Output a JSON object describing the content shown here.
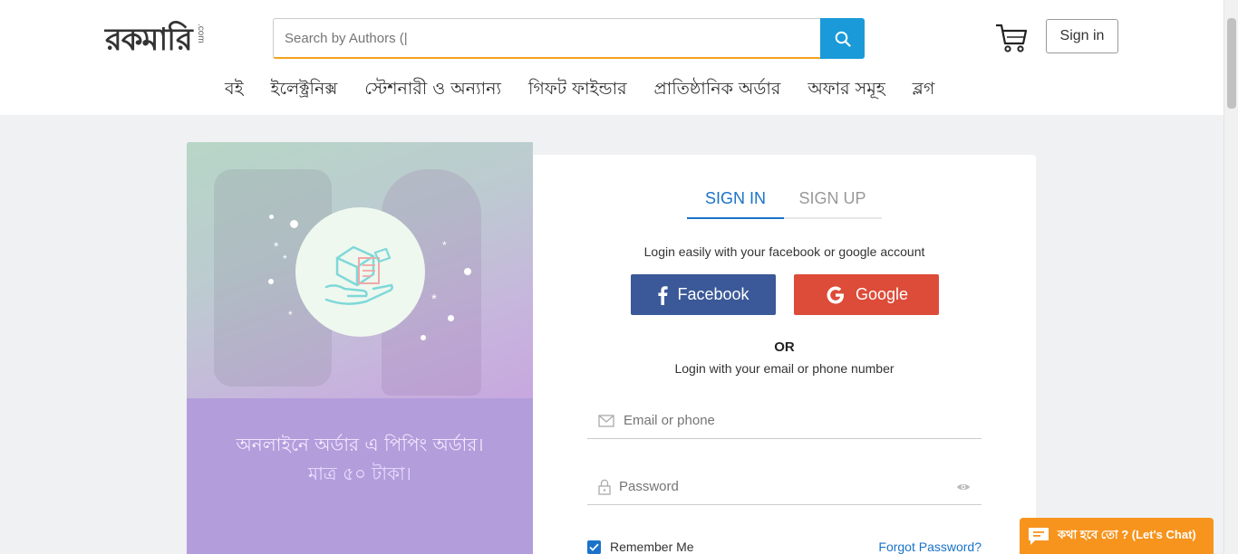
{
  "header": {
    "logo_text": "রকমারি",
    "logo_suffix": ".com",
    "search_placeholder": "Search by Authors (|",
    "signin_label": "Sign in",
    "nav": [
      "বই",
      "ইলেক্ট্রনিক্স",
      "স্টেশনারী ও অন্যান্য",
      "গিফট ফাইন্ডার",
      "প্রাতিষ্ঠানিক অর্ডার",
      "অফার সমূহ",
      "ব্লগ"
    ]
  },
  "promo": {
    "line1": "অনলাইনে অর্ডার এ পিপিং অর্ডার।",
    "line2": "মাত্র ৫০ টাকা।"
  },
  "form": {
    "tab_signin": "SIGN IN",
    "tab_signup": "SIGN UP",
    "social_hint": "Login easily with your facebook or google account",
    "facebook_label": "Facebook",
    "google_label": "Google",
    "or_label": "OR",
    "email_hint": "Login with your email or phone number",
    "email_placeholder": "Email or phone",
    "password_placeholder": "Password",
    "remember_label": "Remember Me",
    "forgot_label": "Forgot Password?"
  },
  "chat": {
    "label": "কথা হবে তো ? (Let's Chat)"
  },
  "colors": {
    "accent_blue": "#1a9ad8",
    "facebook": "#3b5998",
    "google": "#dd4b39",
    "chat": "#f7941d",
    "search_underline": "#f4a21c"
  }
}
